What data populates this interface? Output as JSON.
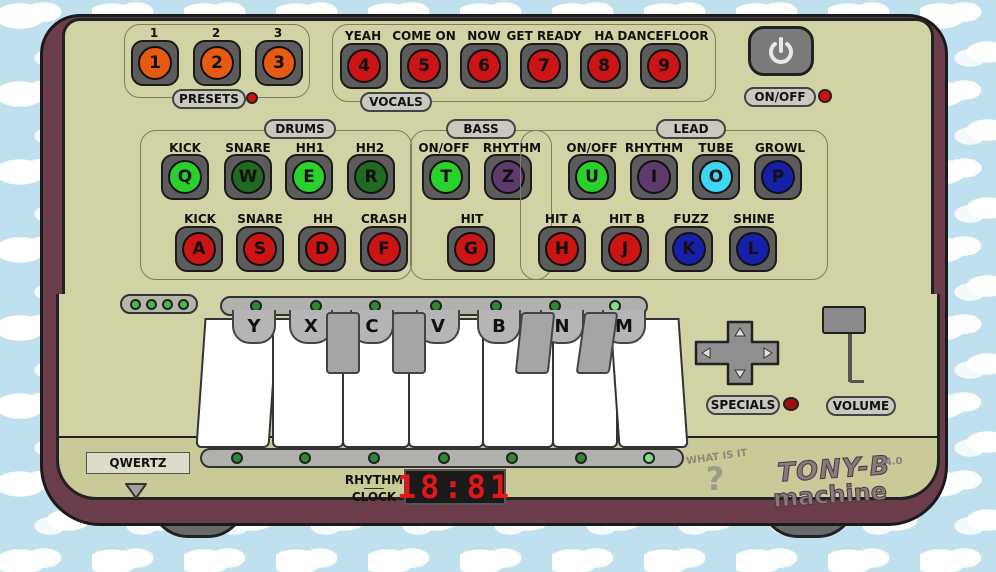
{
  "presets": {
    "top_labels": [
      "1",
      "2",
      "3"
    ],
    "keys": [
      "1",
      "2",
      "3"
    ],
    "label": "PRESETS"
  },
  "vocals": {
    "labels": [
      "YEAH",
      "COME ON",
      "NOW",
      "GET READY",
      "HA",
      "DANCEFLOOR"
    ],
    "keys": [
      "4",
      "5",
      "6",
      "7",
      "8",
      "9"
    ],
    "label": "VOCALS"
  },
  "power": {
    "label": "ON/OFF"
  },
  "drums": {
    "label": "DRUMS",
    "row1_labels": [
      "KICK",
      "SNARE",
      "HH1",
      "HH2"
    ],
    "row1_keys": [
      "Q",
      "W",
      "E",
      "R"
    ],
    "row2_labels": [
      "KICK",
      "SNARE",
      "HH",
      "CRASH"
    ],
    "row2_keys": [
      "A",
      "S",
      "D",
      "F"
    ]
  },
  "bass": {
    "label": "BASS",
    "row1_labels": [
      "ON/OFF",
      "RHYTHM"
    ],
    "row1_keys": [
      "T",
      "Z"
    ],
    "row2_labels": [
      "HIT"
    ],
    "row2_keys": [
      "G"
    ]
  },
  "lead": {
    "label": "LEAD",
    "row1_labels": [
      "ON/OFF",
      "RHYTHM",
      "TUBE",
      "GROWL"
    ],
    "row1_keys": [
      "U",
      "I",
      "O",
      "P"
    ],
    "row2_labels": [
      "HIT A",
      "HIT B",
      "FUZZ",
      "SHINE"
    ],
    "row2_keys": [
      "H",
      "J",
      "K",
      "L"
    ]
  },
  "keyboard": {
    "keys": [
      "Y",
      "X",
      "C",
      "V",
      "B",
      "N",
      "M"
    ]
  },
  "specials": {
    "label": "SPECIALS"
  },
  "volume": {
    "label": "VOLUME",
    "level": 0.2
  },
  "layout_select": {
    "value": "QWERTZ"
  },
  "clock": {
    "label_line1": "RHYTHM",
    "label_line2": "CLOCK",
    "display": "18:81"
  },
  "help": {
    "label": "WHAT IS IT",
    "symbol": "?"
  },
  "logo": {
    "title": "TONY-B",
    "subtitle": "machine",
    "version": "4.0"
  },
  "colors": {
    "orange": "#e65a12",
    "red": "#cc1414",
    "green": "#2bd12b",
    "dark_green": "#1f6a1f",
    "purple": "#5e3a6b",
    "cyan": "#3ad8f2",
    "blue": "#1520a8",
    "led_green": "#3fbf3f",
    "led_red": "#d11010"
  }
}
